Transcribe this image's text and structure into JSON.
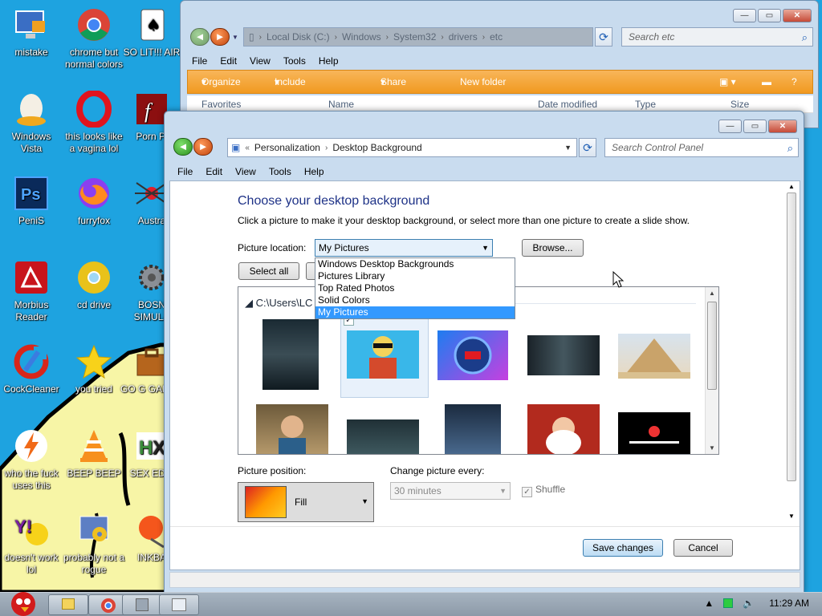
{
  "desktop": {
    "icons": [
      {
        "label": "mistake",
        "icon": "monitor-icon"
      },
      {
        "label": "chrome but normal colors",
        "icon": "chrome-icon"
      },
      {
        "label": "SO LIT!!! AIR",
        "icon": "card-icon"
      },
      {
        "label": "Windows Vista",
        "icon": "egg-icon"
      },
      {
        "label": "this looks like a vagina lol",
        "icon": "opera-icon"
      },
      {
        "label": "Porn Pl",
        "icon": "flash-icon"
      },
      {
        "label": "PeniS",
        "icon": "photoshop-icon"
      },
      {
        "label": "furryfox",
        "icon": "firefox-icon"
      },
      {
        "label": "Austra",
        "icon": "spider-icon"
      },
      {
        "label": "Morbius Reader",
        "icon": "pdf-icon"
      },
      {
        "label": "cd drive",
        "icon": "cd-icon"
      },
      {
        "label": "BOSN SIMULA",
        "icon": "gear-icon"
      },
      {
        "label": "CockCleaner",
        "icon": "ccleaner-icon"
      },
      {
        "label": "you tried",
        "icon": "star-icon"
      },
      {
        "label": "GO G GADGE",
        "icon": "briefcase-icon"
      },
      {
        "label": "who the fuck uses this",
        "icon": "lightning-icon"
      },
      {
        "label": "BEEP BEEP",
        "icon": "vlc-icon"
      },
      {
        "label": "SEX EDIT",
        "icon": "hx-icon"
      },
      {
        "label": "doesn't work lol",
        "icon": "yahoo-icon"
      },
      {
        "label": "probably not a rogue",
        "icon": "settings-icon"
      },
      {
        "label": "INKBA",
        "icon": "pin-icon"
      }
    ]
  },
  "explorer": {
    "breadcrumb": [
      "Local Disk (C:)",
      "Windows",
      "System32",
      "drivers",
      "etc"
    ],
    "search_placeholder": "Search etc",
    "menu": [
      "File",
      "Edit",
      "View",
      "Tools",
      "Help"
    ],
    "toolbar": [
      "Organize",
      "Include in library",
      "Share with",
      "New folder"
    ],
    "favorites": "Favorites",
    "columns": [
      "Name",
      "Date modified",
      "Type",
      "Size"
    ]
  },
  "dialog": {
    "breadcrumb": [
      "Personalization",
      "Desktop Background"
    ],
    "search_placeholder": "Search Control Panel",
    "menu": [
      "File",
      "Edit",
      "View",
      "Tools",
      "Help"
    ],
    "heading": "Choose your desktop background",
    "description": "Click a picture to make it your desktop background, or select more than one picture to create a slide show.",
    "picture_location_label": "Picture location:",
    "picture_location_value": "My Pictures",
    "browse_label": "Browse...",
    "select_all_label": "Select all",
    "location_options": [
      "Windows Desktop Backgrounds",
      "Pictures Library",
      "Top Rated Photos",
      "Solid Colors",
      "My Pictures"
    ],
    "selected_option_index": 4,
    "group_label": "C:\\Users\\LC",
    "thumbnails": [
      "morbius-poster",
      "cartoon-man",
      "made-in-china-badge",
      "morbius-face",
      "pyramid",
      "man-portrait",
      "dark-scene",
      "robot-movie-poster",
      "santa-claus",
      "how-high-can-you-get"
    ],
    "picture_position_label": "Picture position:",
    "picture_position_value": "Fill",
    "change_every_label": "Change picture every:",
    "change_every_value": "30 minutes",
    "shuffle_label": "Shuffle",
    "save_label": "Save changes",
    "cancel_label": "Cancel"
  },
  "taskbar": {
    "clock": "11:29 AM"
  }
}
